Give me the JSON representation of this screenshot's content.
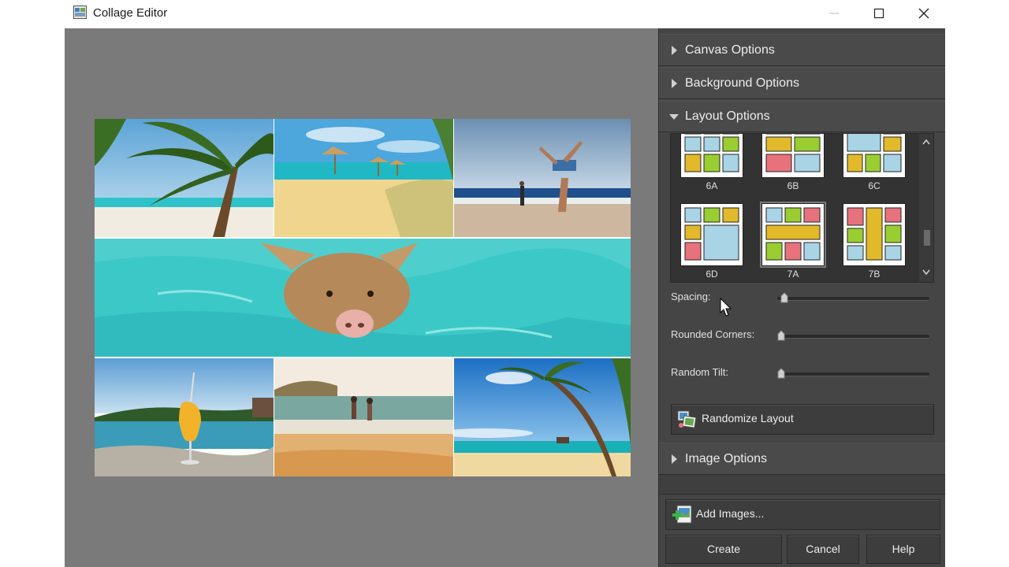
{
  "window": {
    "title": "Collage Editor"
  },
  "canvas": {
    "background_color": "#7a7a7a",
    "photos": [
      {
        "name": "palm-beach-photo"
      },
      {
        "name": "umbrella-beach-photo"
      },
      {
        "name": "cartwheel-beach-photo"
      },
      {
        "name": "swimming-pig-photo"
      },
      {
        "name": "tropical-drink-photo"
      },
      {
        "name": "couple-walking-photo"
      },
      {
        "name": "leaning-palm-photo"
      }
    ]
  },
  "panel": {
    "canvas_options": {
      "label": "Canvas Options",
      "expanded": false
    },
    "background_options": {
      "label": "Background Options",
      "expanded": false
    },
    "layout_options": {
      "label": "Layout Options",
      "expanded": true,
      "layouts": [
        "6A",
        "6B",
        "6C",
        "6D",
        "7A",
        "7B"
      ],
      "selected": "7A"
    },
    "spacing": {
      "label": "Spacing:",
      "value": 0.02
    },
    "rounded_corners": {
      "label": "Rounded Corners:",
      "value": 0
    },
    "random_tilt": {
      "label": "Random Tilt:",
      "value": 0
    },
    "randomize_button": {
      "label": "Randomize Layout",
      "icon": "randomize-icon"
    },
    "image_options": {
      "label": "Image Options",
      "expanded": false
    },
    "add_images_button": {
      "label": "Add Images...",
      "icon": "add-images-icon"
    },
    "create_button": {
      "label": "Create"
    },
    "cancel_button": {
      "label": "Cancel"
    },
    "help_button": {
      "label": "Help"
    }
  },
  "colors": {
    "panel_bg": "#454545",
    "layout_blue": "#a8d4e6",
    "layout_red": "#e8727c",
    "layout_yellow": "#e2b92a",
    "layout_green": "#9acd32"
  }
}
